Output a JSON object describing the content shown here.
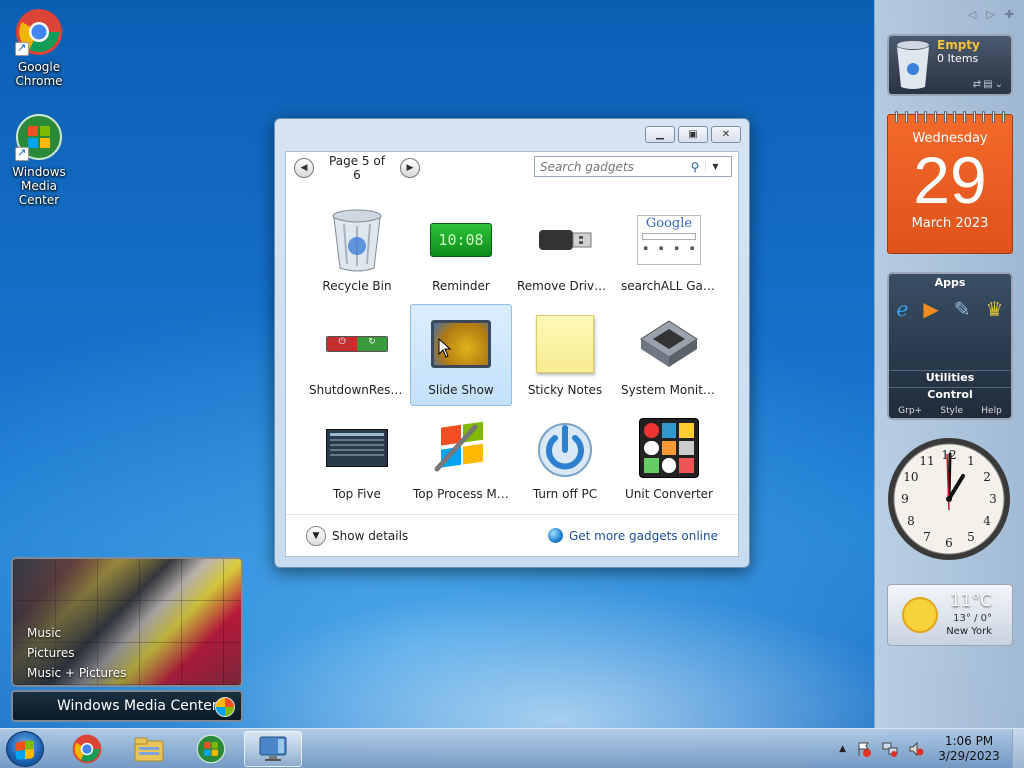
{
  "desktop": {
    "icons": [
      {
        "label": "Google Chrome"
      },
      {
        "label": "Windows Media Center"
      }
    ]
  },
  "gallery": {
    "page_label": "Page 5 of 6",
    "search_placeholder": "Search gadgets",
    "gadgets": [
      {
        "name": "Recycle Bin"
      },
      {
        "name": "Reminder",
        "display": "10:08"
      },
      {
        "name": "Remove Drive S..."
      },
      {
        "name": "searchALL Gadg..."
      },
      {
        "name": "ShutdownRestart"
      },
      {
        "name": "Slide Show",
        "selected": true
      },
      {
        "name": "Sticky Notes"
      },
      {
        "name": "System Monitor II"
      },
      {
        "name": "Top Five"
      },
      {
        "name": "Top Process Mo..."
      },
      {
        "name": "Turn off PC"
      },
      {
        "name": "Unit Converter"
      }
    ],
    "show_details": "Show details",
    "more_online": "Get more gadgets online",
    "google_text": "Google"
  },
  "sidebar": {
    "recycle": {
      "status": "Empty",
      "items": "0 Items"
    },
    "calendar": {
      "weekday": "Wednesday",
      "day": "29",
      "month_year": "March 2023"
    },
    "apps": {
      "header": "Apps",
      "row1": "Utilities",
      "row2": "Control",
      "footer": [
        "Grp+",
        "Style",
        "Help"
      ]
    },
    "clock": {
      "numerals": [
        "12",
        "1",
        "2",
        "3",
        "4",
        "5",
        "6",
        "7",
        "8",
        "9",
        "10",
        "11"
      ]
    },
    "weather": {
      "temp": "11°C",
      "range": "13° / 0°",
      "city": "New York"
    }
  },
  "media_center": {
    "menu": [
      "Music",
      "Pictures",
      "Music + Pictures"
    ],
    "title": "Windows Media Center"
  },
  "taskbar": {
    "time": "1:06 PM",
    "date": "3/29/2023"
  },
  "colors": {
    "calendar_orange": "#f26a2b",
    "accent_blue": "#1d4fa0",
    "recycle_yellow": "#f7c23a"
  }
}
